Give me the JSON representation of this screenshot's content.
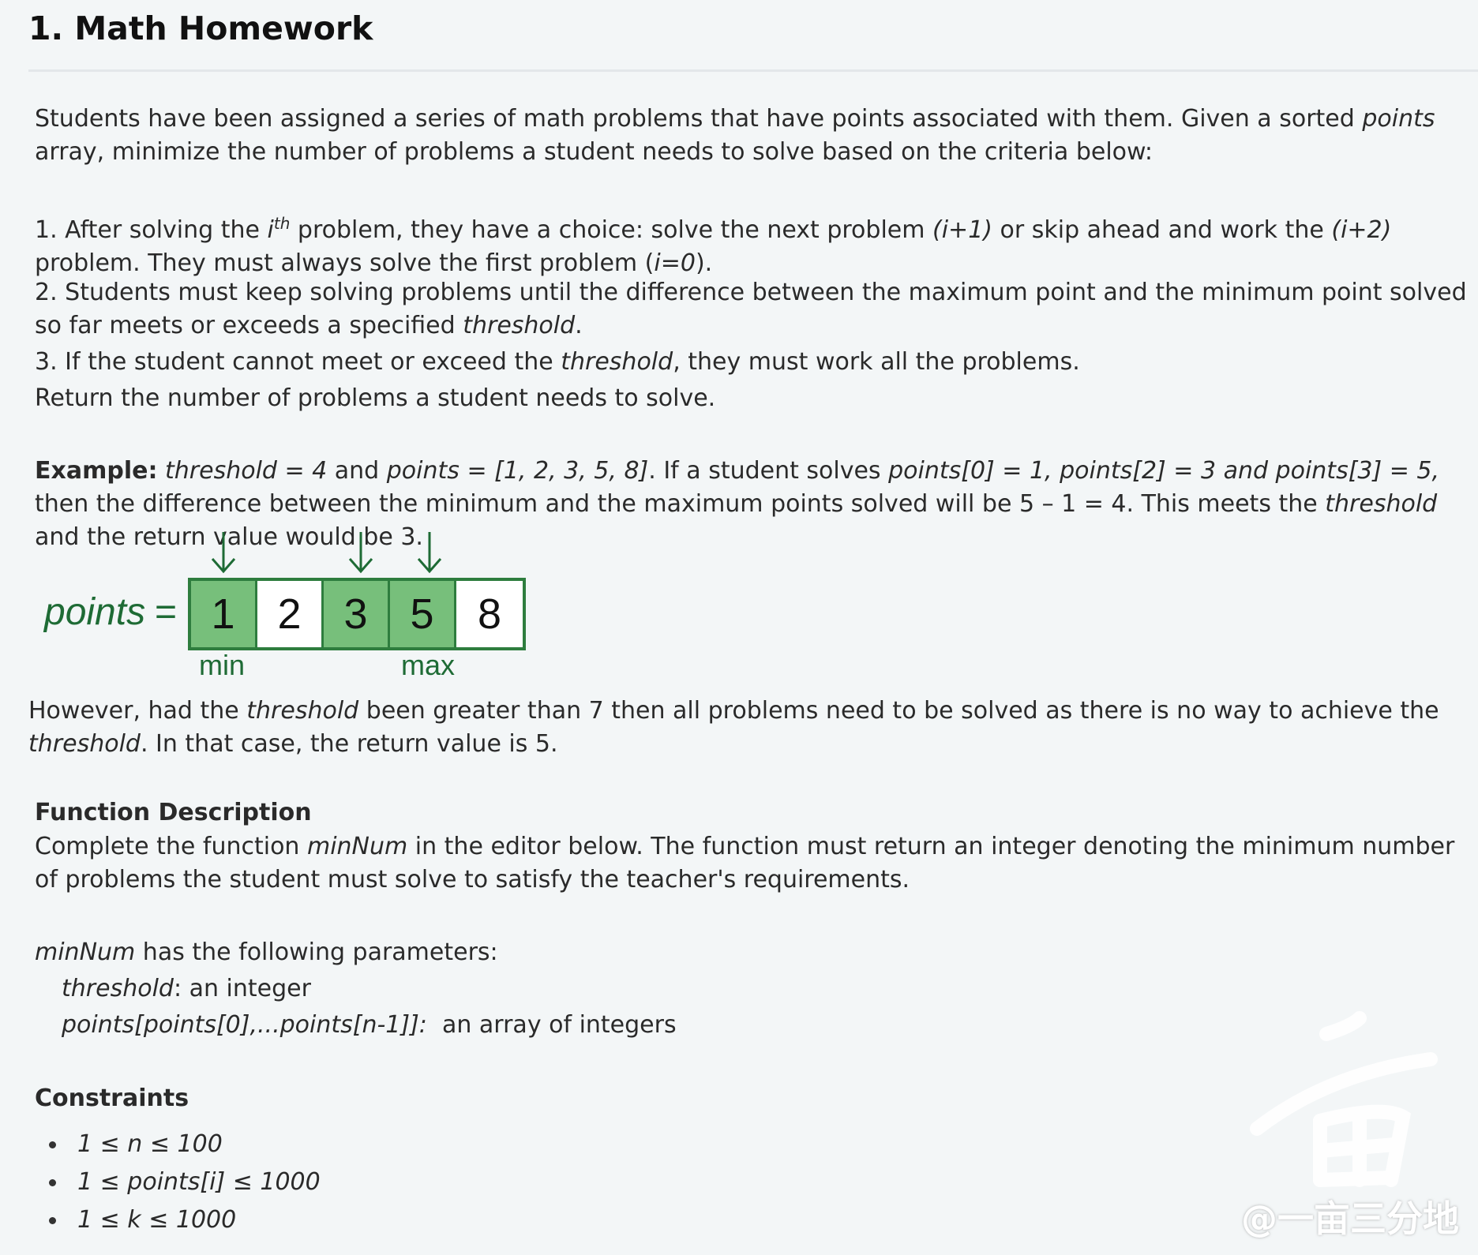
{
  "title": "1. Math Homework",
  "intro": {
    "a": "Students have been assigned a series of math problems that have points associated with them. Given a sorted ",
    "b": "points",
    "c": " array, minimize the number of problems a student needs to solve based on the criteria below:"
  },
  "rule1": {
    "a": "1. After solving the ",
    "b": "i",
    "sup": "th",
    "c": " problem, they have a choice: solve the next problem ",
    "d": "(i+1)",
    "e": " or skip ahead and work the ",
    "f": "(i+2)",
    "g": " problem. They must always solve the first problem (",
    "h": "i=0",
    "i": ")."
  },
  "rule2": {
    "a": "2. Students must keep solving problems until the difference between the maximum point and the minimum point solved so far meets or exceeds a specified ",
    "b": "threshold",
    "c": "."
  },
  "rule3": {
    "a": "3. If the student cannot meet or exceed the ",
    "b": "threshold",
    "c": ", they must work all the problems."
  },
  "return_text": "Return the number of problems a student needs to solve.",
  "example": {
    "label": "Example:",
    "a": " ",
    "b": "threshold = 4",
    "c": " and ",
    "d": "points = [1, 2, 3, 5, 8]",
    "e": ". If a student solves ",
    "f": "points[0] = 1, points[2] = 3 and points[3] = 5,",
    "g": " then the difference between the minimum and the maximum points solved will be 5 – 1 = 4. This meets the ",
    "h": "threshold",
    "i": " and the return value would be 3."
  },
  "diagram": {
    "label": "points",
    "eq": "=",
    "cells": [
      "1",
      "2",
      "3",
      "5",
      "8"
    ],
    "selected": [
      true,
      false,
      true,
      true,
      false
    ],
    "min_label": "min",
    "max_label": "max",
    "color_selected": "#77bf7b",
    "color_border": "#2e7d3e",
    "color_text": "#1e6b35"
  },
  "however": {
    "a": "However, had the ",
    "b": "threshold",
    "c": " been greater than 7 then all problems need to be solved as there is no way to achieve the ",
    "d": "threshold",
    "e": ". In that case, the return value is 5."
  },
  "function_description": {
    "heading": "Function Description",
    "a": "Complete the function ",
    "b": "minNum",
    "c": " in the editor below. The function must return an integer denoting the minimum number of problems the student must solve to satisfy the teacher's requirements."
  },
  "params": {
    "a": "minNum",
    "b": " has the following parameters:",
    "p1_name": "threshold",
    "p1_desc": ": an integer",
    "p2_name": "points[points[0],...points[n-1]]:",
    "p2_desc": "  an array of integers"
  },
  "constraints": {
    "heading": "Constraints",
    "items": [
      "1 ≤ n ≤ 100",
      "1 ≤ points[i] ≤ 1000",
      "1 ≤ k ≤ 1000"
    ]
  },
  "watermark": "@一亩三分地"
}
